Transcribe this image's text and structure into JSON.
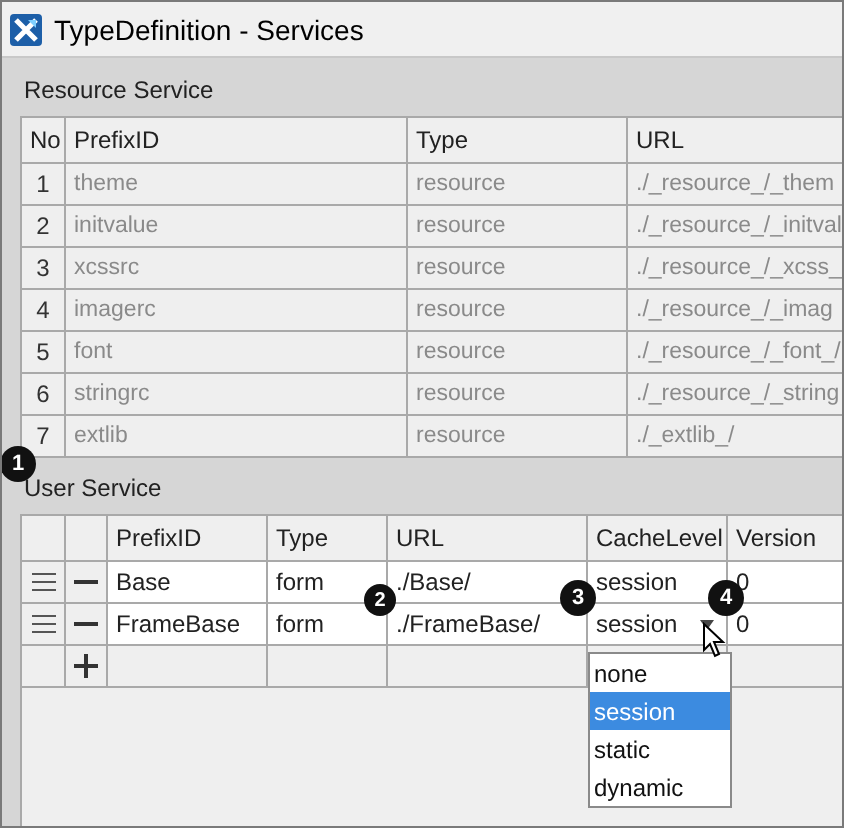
{
  "window": {
    "title": "TypeDefinition - Services"
  },
  "resource_service": {
    "title": "Resource Service",
    "disabled": true,
    "columns": [
      "No",
      "PrefixID",
      "Type",
      "URL"
    ],
    "rows": [
      {
        "no": "1",
        "prefix_id": "theme",
        "type": "resource",
        "url": "./_resource_/_them"
      },
      {
        "no": "2",
        "prefix_id": "initvalue",
        "type": "resource",
        "url": "./_resource_/_initval"
      },
      {
        "no": "3",
        "prefix_id": "xcssrc",
        "type": "resource",
        "url": "./_resource_/_xcss_"
      },
      {
        "no": "4",
        "prefix_id": "imagerc",
        "type": "resource",
        "url": "./_resource_/_imag"
      },
      {
        "no": "5",
        "prefix_id": "font",
        "type": "resource",
        "url": "./_resource_/_font_/"
      },
      {
        "no": "6",
        "prefix_id": "stringrc",
        "type": "resource",
        "url": "./_resource_/_string"
      },
      {
        "no": "7",
        "prefix_id": "extlib",
        "type": "resource",
        "url": "./_extlib_/"
      }
    ]
  },
  "user_service": {
    "title": "User Service",
    "columns": [
      "PrefixID",
      "Type",
      "URL",
      "CacheLevel",
      "Version"
    ],
    "rows": [
      {
        "prefix_id": "Base",
        "type": "form",
        "url": "./Base/",
        "cache_level": "session",
        "version": "0",
        "dropdown_open": false
      },
      {
        "prefix_id": "FrameBase",
        "type": "form",
        "url": "./FrameBase/",
        "cache_level": "session",
        "version": "0",
        "dropdown_open": true
      }
    ],
    "dropdown_options": [
      {
        "label": "none",
        "selected": false
      },
      {
        "label": "session",
        "selected": true
      },
      {
        "label": "static",
        "selected": false
      },
      {
        "label": "dynamic",
        "selected": false
      }
    ]
  },
  "callouts": [
    "1",
    "2",
    "3",
    "4"
  ]
}
